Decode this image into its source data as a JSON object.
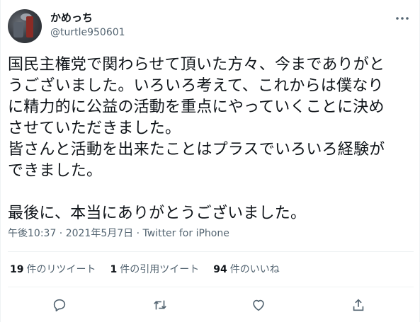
{
  "tweet": {
    "display_name": "かめっち",
    "handle": "@turtle950601",
    "text": "国民主権党で関わらせて頂いた方々、今までありがと\nうございました。いろいろ考えて、これからは僕なり\nに精力的に公益の活動を重点にやっていくことに決め\nさせていただきました。\n皆さんと活動を出来たことはプラスでいろいろ経験が\nできました。\n\n最後に、本当にありがとうございました。",
    "timestamp": "午後10:37 · 2021年5月7日 · ",
    "source": "Twitter for iPhone"
  },
  "stats": {
    "retweets_count": "19",
    "retweets_label": "件のリツイート",
    "quotes_count": "1",
    "quotes_label": "件の引用ツイート",
    "likes_count": "94",
    "likes_label": "件のいいね"
  },
  "icons": {
    "more": "more-options-icon",
    "reply": "reply-icon",
    "retweet": "retweet-icon",
    "like": "like-icon",
    "share": "share-icon"
  },
  "colors": {
    "text": "#0f1419",
    "secondary": "#536471",
    "divider": "#eff3f4"
  }
}
